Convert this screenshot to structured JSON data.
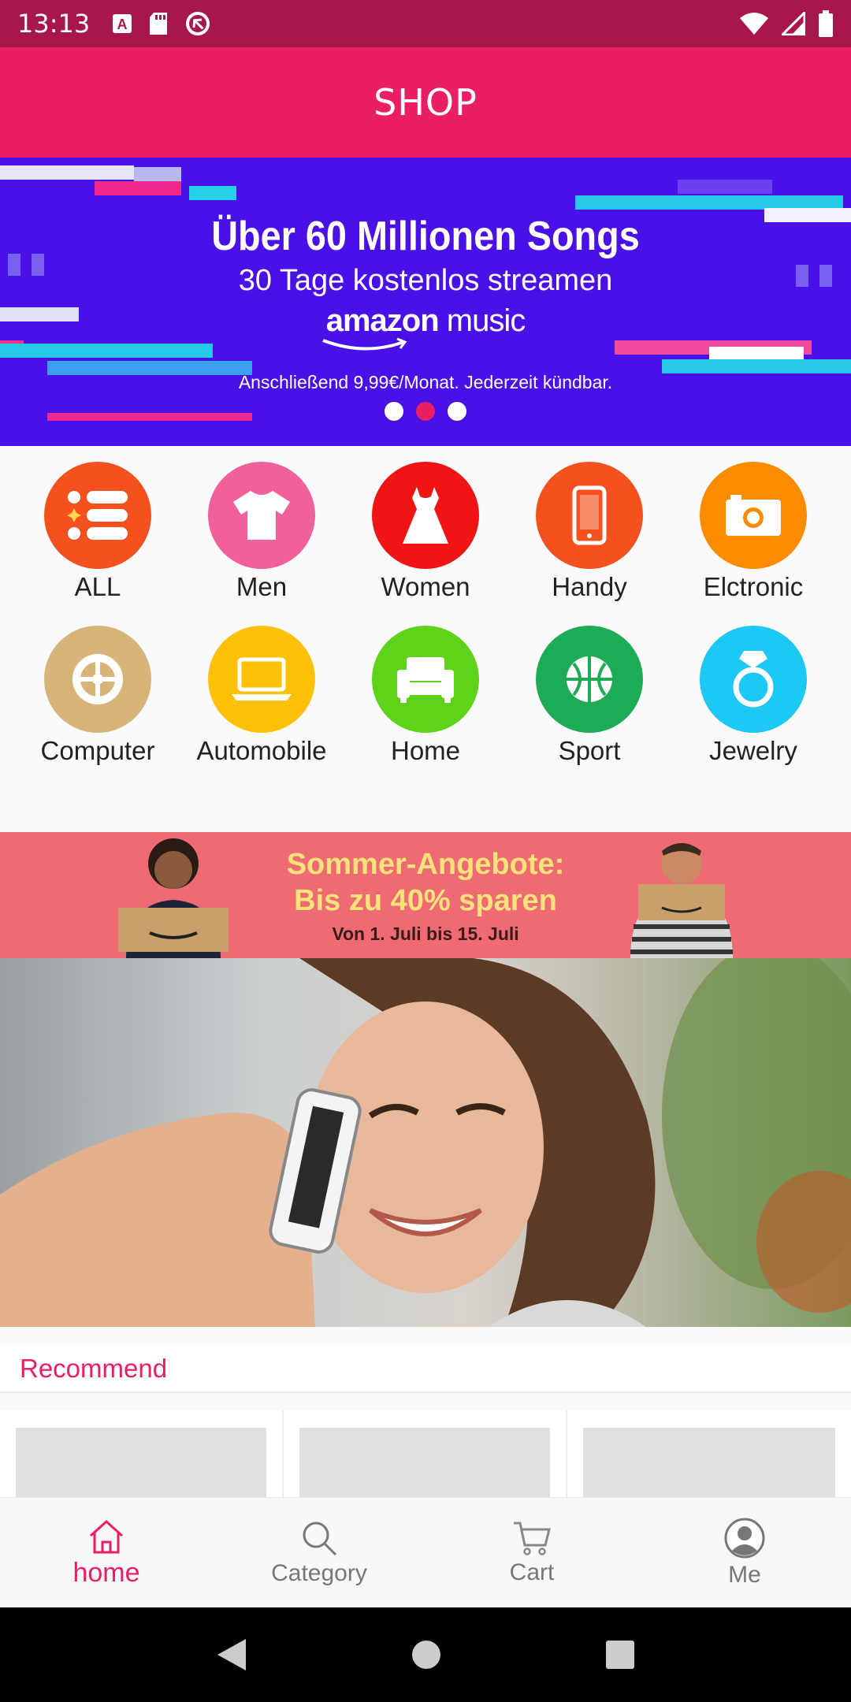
{
  "status_bar": {
    "time": "13:13",
    "left_icons": [
      "a-notification-icon",
      "sd-card-icon",
      "sync-icon"
    ],
    "right_icons": [
      "wifi-icon",
      "signal-icon",
      "battery-icon"
    ]
  },
  "app_bar": {
    "title": "SHOP"
  },
  "hero_banner": {
    "line1": "Über 60 Millionen Songs",
    "line2": "30 Tage kostenlos streamen",
    "brand_bold": "amazon",
    "brand_light": "music",
    "footnote": "Anschließend 9,99€/Monat. Jederzeit kündbar.",
    "slides": 3,
    "active_slide": 2
  },
  "categories": [
    {
      "label": "ALL",
      "icon": "list-icon",
      "color": "#f4511e"
    },
    {
      "label": "Men",
      "icon": "tshirt-icon",
      "color": "#f0609a"
    },
    {
      "label": "Women",
      "icon": "dress-icon",
      "color": "#f01414"
    },
    {
      "label": "Handy",
      "icon": "phone-icon",
      "color": "#f4511e"
    },
    {
      "label": "Elctronic",
      "icon": "camera-icon",
      "color": "#fb8c00"
    },
    {
      "label": "Computer",
      "icon": "wheel-icon",
      "color": "#d7b47a"
    },
    {
      "label": "Automobile",
      "icon": "laptop-icon",
      "color": "#ffc107"
    },
    {
      "label": "Home",
      "icon": "sofa-icon",
      "color": "#5fd31a"
    },
    {
      "label": "Sport",
      "icon": "ball-icon",
      "color": "#1eab55"
    },
    {
      "label": "Jewelry",
      "icon": "ring-icon",
      "color": "#1ec8f5"
    }
  ],
  "promo_banner": {
    "line1": "Sommer-Angebote:",
    "line2": "Bis zu 40% sparen",
    "line3": "Von 1. Juli bis 15. Juli"
  },
  "recommend": {
    "label": "Recommend"
  },
  "bottom_nav": [
    {
      "label": "home",
      "icon": "home-icon",
      "active": true
    },
    {
      "label": "Category",
      "icon": "search-icon",
      "active": false
    },
    {
      "label": "Cart",
      "icon": "cart-icon",
      "active": false
    },
    {
      "label": "Me",
      "icon": "person-icon",
      "active": false
    }
  ],
  "colors": {
    "primary": "#e91e63",
    "status_bar": "#a8174b",
    "hero_bg": "#4a10e8",
    "promo_bg": "#f06a73"
  }
}
